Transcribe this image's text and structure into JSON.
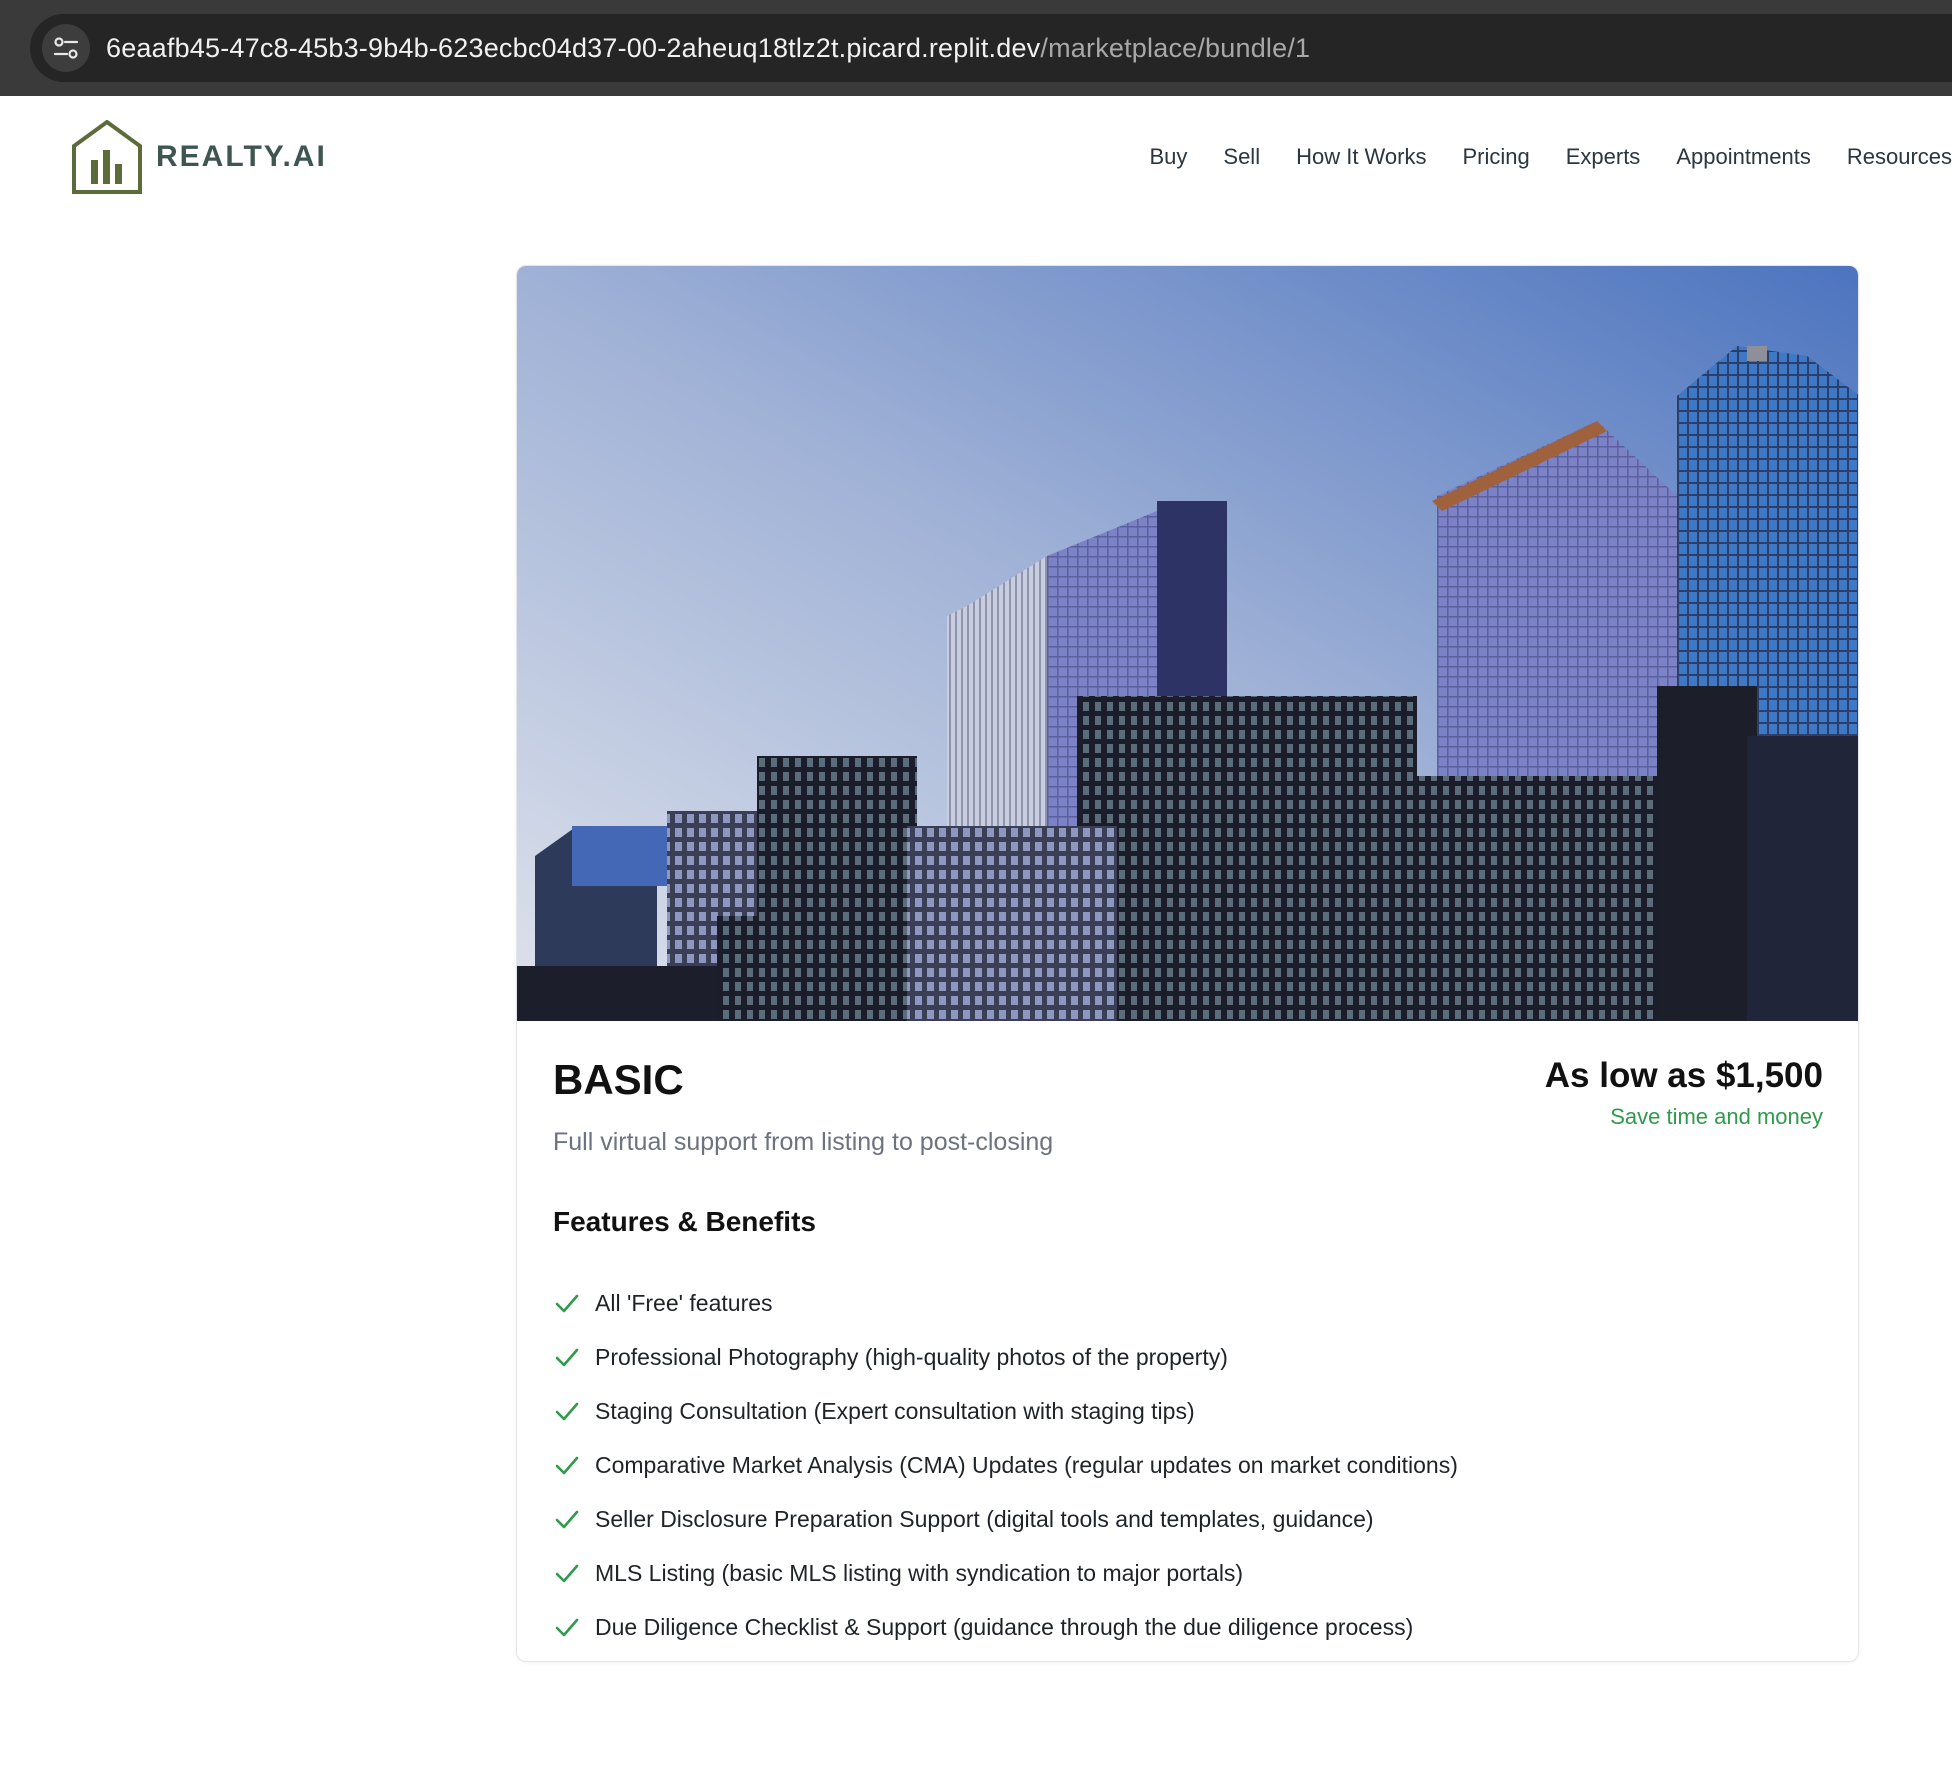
{
  "browser": {
    "url_host": "6eaafb45-47c8-45b3-9b4b-623ecbc04d37-00-2aheuq18tlz2t.picard.replit.dev",
    "url_path": "/marketplace/bundle/1",
    "site_info_icon": "tune-icon"
  },
  "header": {
    "logo_text": "REALTY.AI",
    "logo_icon": "house-chart-icon",
    "nav": [
      "Buy",
      "Sell",
      "How It Works",
      "Pricing",
      "Experts",
      "Appointments",
      "Resources"
    ]
  },
  "bundle": {
    "title": "BASIC",
    "subtitle": "Full virtual support from listing to post-closing",
    "price": "As low as $1,500",
    "price_note": "Save time and money",
    "features_heading": "Features & Benefits",
    "features": [
      "All 'Free' features",
      "Professional Photography (high-quality photos of the property)",
      "Staging Consultation (Expert consultation with staging tips)",
      "Comparative Market Analysis (CMA) Updates (regular updates on market conditions)",
      "Seller Disclosure Preparation Support (digital tools and templates, guidance)",
      "MLS Listing (basic MLS listing with syndication to major portals)",
      "Due Diligence Checklist & Support (guidance through the due diligence process)"
    ]
  },
  "colors": {
    "brand": "#5b6b3a",
    "brand_text": "#3f5552",
    "accent_green": "#2f9a4b",
    "browser_bg": "#3a3a3a"
  }
}
